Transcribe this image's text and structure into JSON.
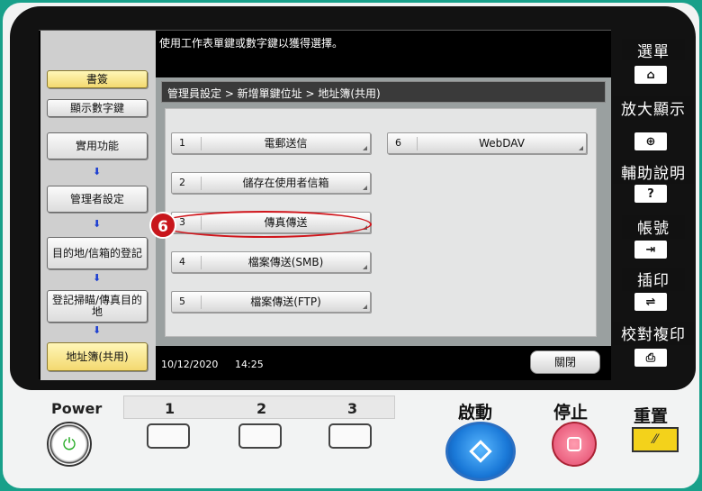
{
  "message": "使用工作表單鍵或數字鍵以獲得選擇。",
  "left_panel": {
    "bookmark": "書簽",
    "show_numpad": "顯示數字鍵",
    "steps": [
      "實用功能",
      "管理者設定",
      "目的地/信箱的登記",
      "登記掃瞄/傳真目的地",
      "地址簿(共用)"
    ]
  },
  "breadcrumb": "管理員設定 > 新增單鍵位址 > 地址簿(共用)",
  "menu": [
    {
      "num": "1",
      "label": "電郵送信"
    },
    {
      "num": "2",
      "label": "儲存在使用者信箱"
    },
    {
      "num": "3",
      "label": "傳真傳送"
    },
    {
      "num": "4",
      "label": "檔案傳送(SMB)"
    },
    {
      "num": "5",
      "label": "檔案傳送(FTP)"
    },
    {
      "num": "6",
      "label": "WebDAV"
    }
  ],
  "callout_number": "6",
  "status": {
    "date": "10/12/2020",
    "time": "14:25",
    "close_label": "關閉"
  },
  "right_panel": {
    "menu": "選單",
    "zoom": "放大顯示",
    "help": "輔助說明",
    "account": "帳號",
    "interrupt": "插印",
    "proof": "校對複印",
    "help_icon": "?"
  },
  "hardware": {
    "power": "Power",
    "keys": [
      "1",
      "2",
      "3"
    ],
    "start": "啟動",
    "stop": "停止",
    "reset": "重置"
  },
  "colors": {
    "highlight": "#d0161c",
    "start": "#1a79d8",
    "stop": "#e2466a",
    "reset": "#f3d21b"
  }
}
